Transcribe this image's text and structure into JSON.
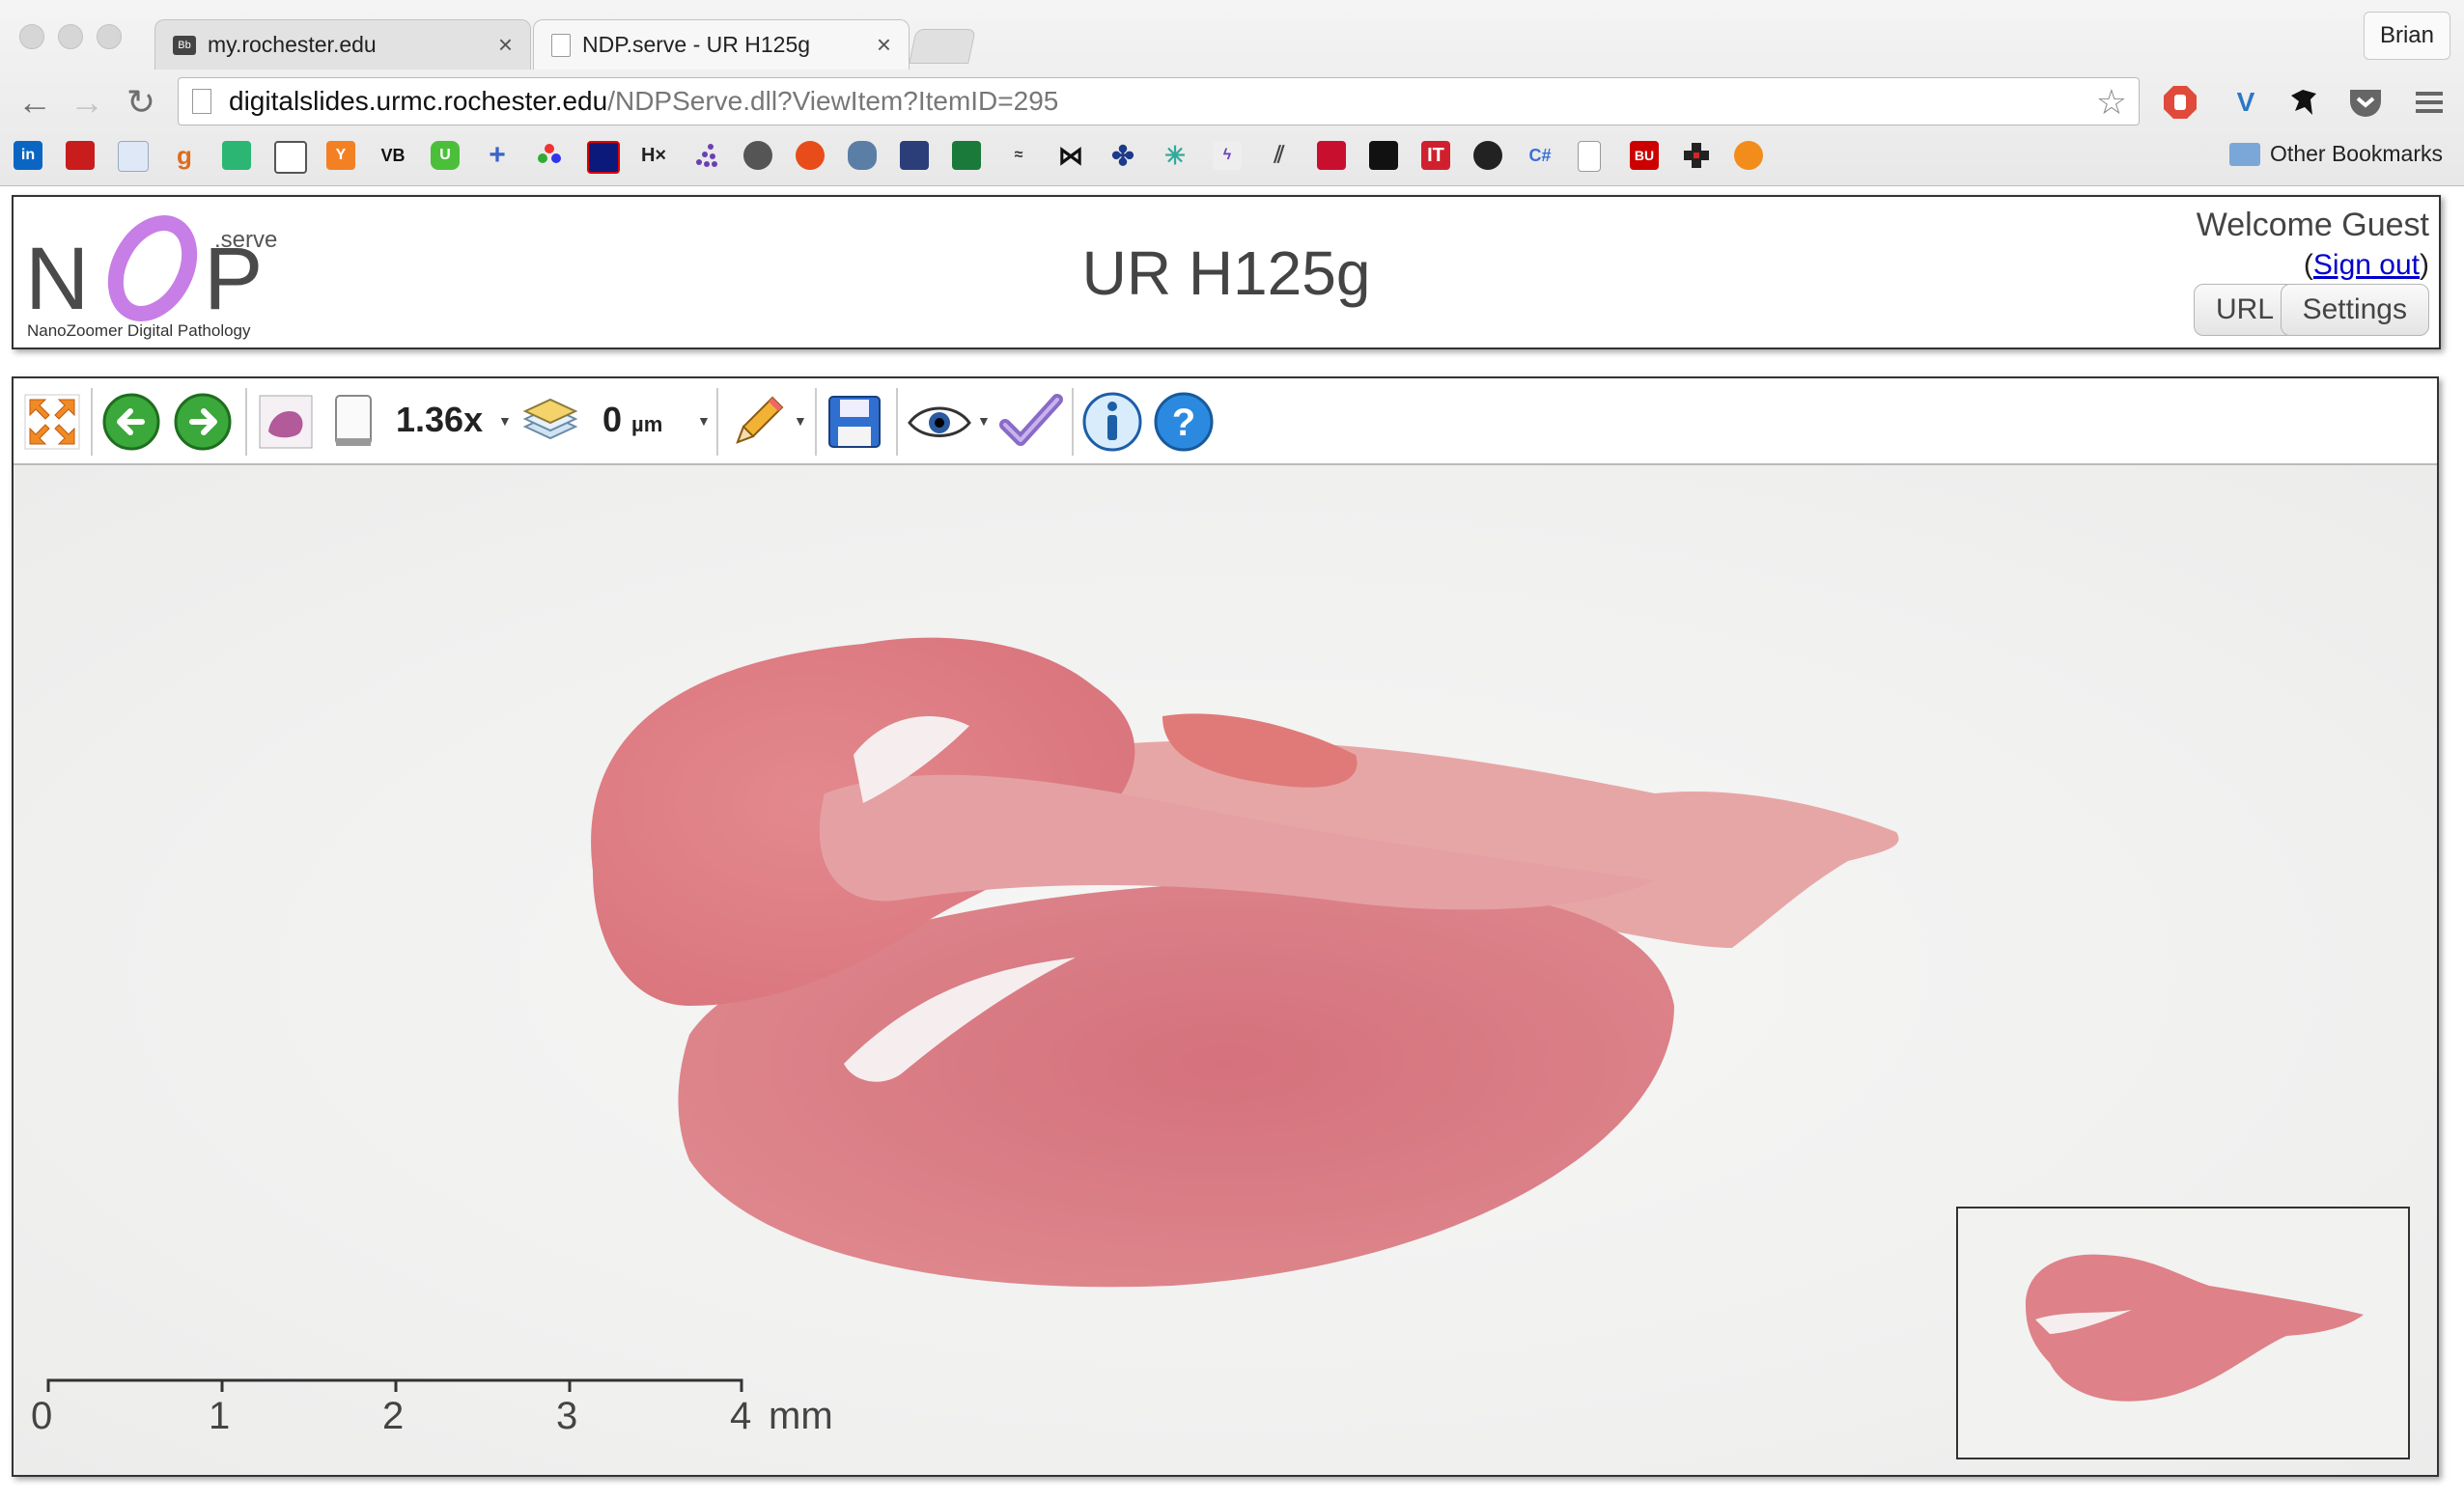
{
  "browser": {
    "tabs": [
      {
        "title": "my.rochester.edu",
        "close": "×"
      },
      {
        "title": "NDP.serve - UR H125g",
        "close": "×"
      }
    ],
    "profile": "Brian",
    "url_host": "digitalslides.urmc.rochester.edu",
    "url_path": "/NDPServe.dll?ViewItem?ItemID=295",
    "nav_icons": [
      "back-icon",
      "forward-icon",
      "reload-icon",
      "bookmark-star-icon"
    ],
    "extension_icons": [
      "adblock-icon",
      "vimeo-icon",
      "bird-icon",
      "pocket-icon",
      "menu-icon"
    ],
    "bookmarks_bar": {
      "items": [
        "in",
        "",
        "",
        "g",
        "",
        "",
        "Y",
        "VB",
        "U",
        "+",
        "",
        "",
        "H×",
        "",
        "",
        "",
        "",
        "",
        "",
        "",
        "",
        "",
        "",
        "",
        "",
        "",
        "",
        "",
        "",
        "IT",
        "",
        "C#",
        "",
        "BU",
        "",
        ""
      ],
      "other": "Other Bookmarks"
    }
  },
  "ndp": {
    "logo": {
      "letters": "NDP",
      "suffix": ".serve",
      "tagline": "NanoZoomer Digital Pathology"
    },
    "title": "UR H125g",
    "welcome": "Welcome Guest",
    "signout_open": "(",
    "signout": "Sign out",
    "signout_close": ")",
    "url_button": "URL",
    "settings_button": "Settings"
  },
  "toolbar": {
    "magnification": "1.36x",
    "focus_value": "0",
    "focus_unit": "µm",
    "icons": [
      "fit-to-screen-icon",
      "back-arrow-icon",
      "forward-arrow-icon",
      "slide-thumbnail-icon",
      "slide-label-icon",
      "layers-icon",
      "annotation-pencil-icon",
      "save-icon",
      "view-eye-icon",
      "checkmark-icon",
      "info-icon",
      "help-icon"
    ]
  },
  "scalebar": {
    "ticks": [
      "0",
      "1",
      "2",
      "3",
      "4"
    ],
    "unit": "mm"
  },
  "colors": {
    "tissue_light": "#e8a3a6",
    "tissue_mid": "#d9787e",
    "tissue_dark": "#c95c66",
    "background": "#f3f3f2"
  }
}
